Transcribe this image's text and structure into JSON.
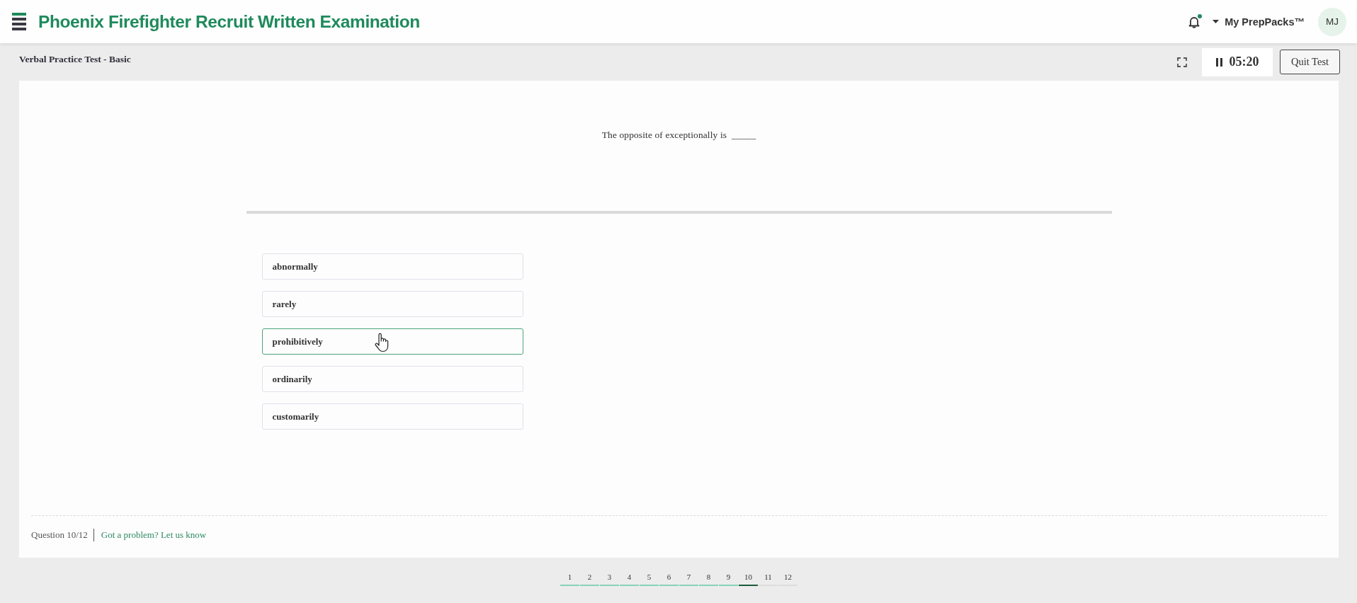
{
  "header": {
    "title": "Phoenix Firefighter Recruit Written Examination",
    "notifications_unread": true,
    "account_menu": "My PrepPacks™",
    "avatar_initials": "MJ"
  },
  "test_bar": {
    "title": "Verbal Practice Test - Basic",
    "timer": "05:20",
    "running": true,
    "quit_label": "Quit Test"
  },
  "question": {
    "prompt": "The opposite of exceptionally is  _____"
  },
  "options": [
    {
      "label": "abnormally",
      "hovered": false
    },
    {
      "label": "rarely",
      "hovered": false
    },
    {
      "label": "prohibitively",
      "hovered": true
    },
    {
      "label": "ordinarily",
      "hovered": false
    },
    {
      "label": "customarily",
      "hovered": false
    }
  ],
  "footer": {
    "progress": "Question 10/12",
    "report_link": "Got a problem? Let us know"
  },
  "pagination": [
    {
      "label": "1",
      "selected": false,
      "answered": true
    },
    {
      "label": "2",
      "selected": false,
      "answered": true
    },
    {
      "label": "3",
      "selected": false,
      "answered": true
    },
    {
      "label": "4",
      "selected": false,
      "answered": true
    },
    {
      "label": "5",
      "selected": false,
      "answered": true
    },
    {
      "label": "6",
      "selected": false,
      "answered": true
    },
    {
      "label": "7",
      "selected": false,
      "answered": true
    },
    {
      "label": "8",
      "selected": false,
      "answered": true
    },
    {
      "label": "9",
      "selected": false,
      "answered": true
    },
    {
      "label": "10",
      "selected": true,
      "answered": false
    },
    {
      "label": "11",
      "selected": false,
      "answered": false
    },
    {
      "label": "12",
      "selected": false,
      "answered": false
    }
  ]
}
